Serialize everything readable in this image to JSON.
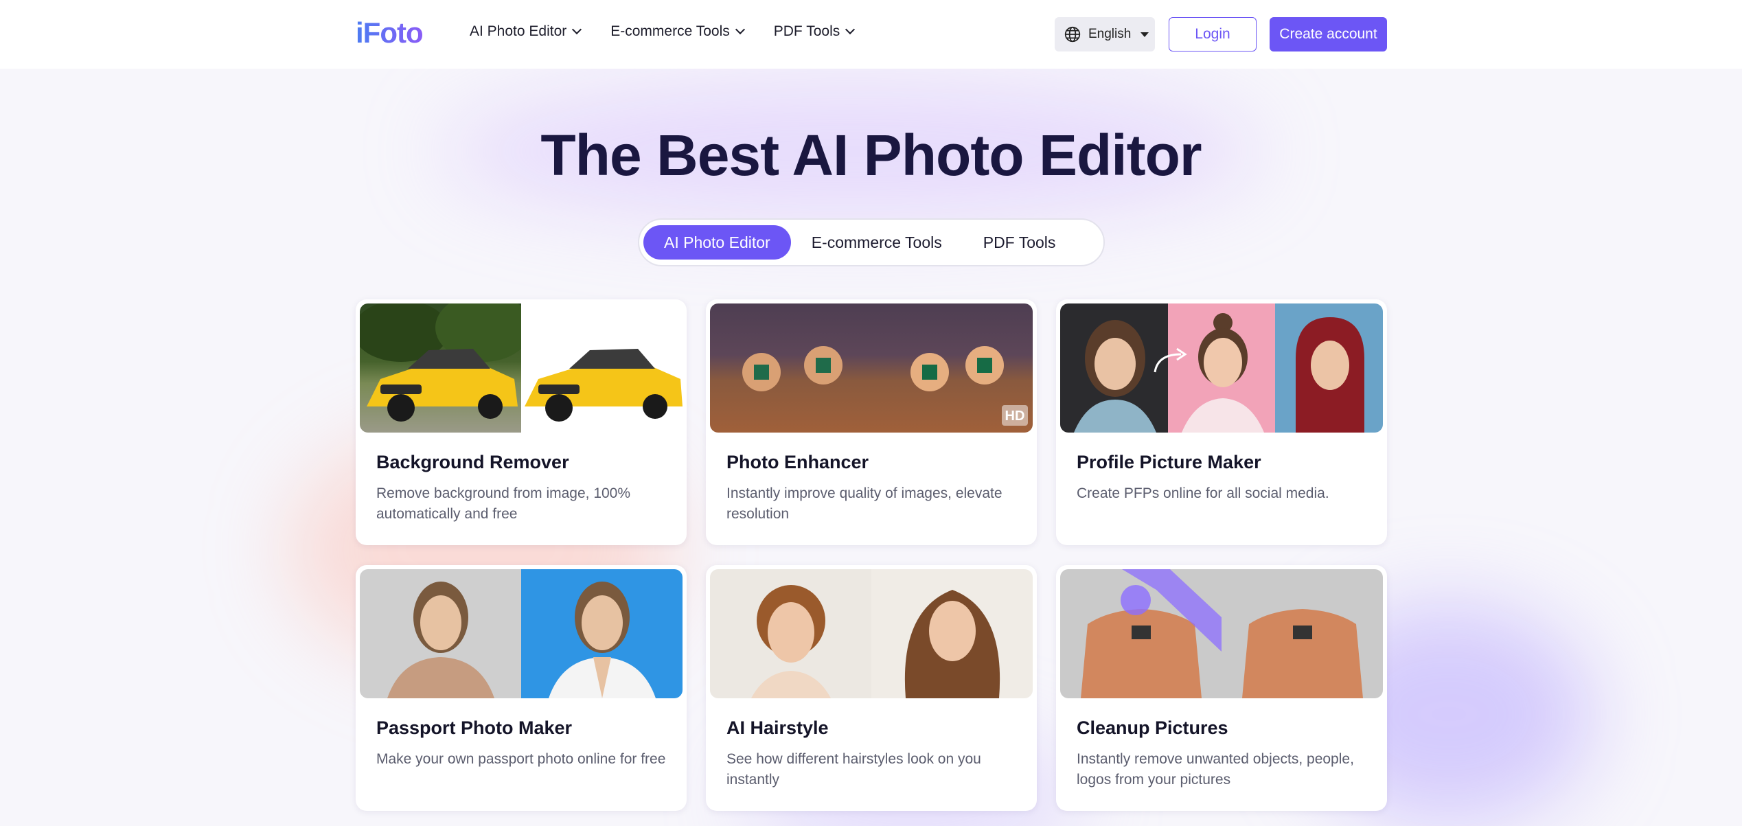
{
  "header": {
    "logo": "iFoto",
    "nav": [
      {
        "label": "AI Photo Editor"
      },
      {
        "label": "E-commerce Tools"
      },
      {
        "label": "PDF Tools"
      }
    ],
    "language": "English",
    "login_label": "Login",
    "create_label": "Create account"
  },
  "hero": {
    "title": "The Best AI Photo Editor"
  },
  "tabs": [
    {
      "label": "AI Photo Editor",
      "active": true
    },
    {
      "label": "E-commerce Tools",
      "active": false
    },
    {
      "label": "PDF Tools",
      "active": false
    }
  ],
  "cards": [
    {
      "title": "Background Remover",
      "desc": "Remove background from image, 100% automatically and free"
    },
    {
      "title": "Photo Enhancer",
      "desc": "Instantly improve quality of images, elevate resolution",
      "badge": "HD"
    },
    {
      "title": "Profile Picture Maker",
      "desc": "Create PFPs online for all social media."
    },
    {
      "title": "Passport Photo Maker",
      "desc": "Make your own passport photo online for free"
    },
    {
      "title": "AI Hairstyle",
      "desc": "See how different hairstyles look on you instantly"
    },
    {
      "title": "Cleanup Pictures",
      "desc": "Instantly remove unwanted objects, people, logos from your pictures"
    }
  ],
  "colors": {
    "accent": "#6c56f5",
    "title": "#1a1740",
    "background": "#f7f6fb"
  }
}
